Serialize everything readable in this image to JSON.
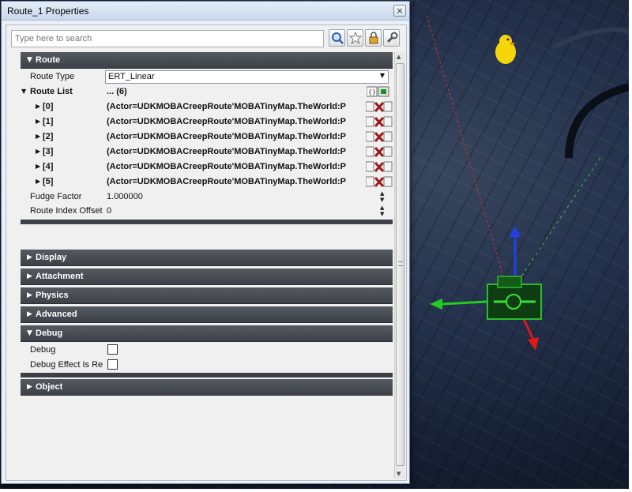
{
  "window": {
    "title": "Route_1 Properties",
    "close_glyph": "×"
  },
  "search": {
    "placeholder": "Type here to search",
    "tools": [
      "search-icon",
      "favorite-star-icon",
      "lock-icon",
      "wrench-settings-icon"
    ]
  },
  "categories": {
    "route": {
      "label": "Route",
      "expanded": true
    },
    "display": {
      "label": "Display",
      "expanded": false
    },
    "attachment": {
      "label": "Attachment",
      "expanded": false
    },
    "physics": {
      "label": "Physics",
      "expanded": false
    },
    "advanced": {
      "label": "Advanced",
      "expanded": false
    },
    "debug": {
      "label": "Debug",
      "expanded": true
    },
    "object": {
      "label": "Object",
      "expanded": false
    }
  },
  "route": {
    "route_type_label": "Route Type",
    "route_type_value": "ERT_Linear",
    "route_list_label": "Route List",
    "route_list_value": "... (6)",
    "entries": [
      {
        "index": "[0]",
        "value": "(Actor=UDKMOBACreepRoute'MOBATinyMap.TheWorld:P"
      },
      {
        "index": "[1]",
        "value": "(Actor=UDKMOBACreepRoute'MOBATinyMap.TheWorld:P"
      },
      {
        "index": "[2]",
        "value": "(Actor=UDKMOBACreepRoute'MOBATinyMap.TheWorld:P"
      },
      {
        "index": "[3]",
        "value": "(Actor=UDKMOBACreepRoute'MOBATinyMap.TheWorld:P"
      },
      {
        "index": "[4]",
        "value": "(Actor=UDKMOBACreepRoute'MOBATinyMap.TheWorld:P"
      },
      {
        "index": "[5]",
        "value": "(Actor=UDKMOBACreepRoute'MOBATinyMap.TheWorld:P"
      }
    ],
    "fudge_factor_label": "Fudge Factor",
    "fudge_factor_value": "1.000000",
    "route_index_offset_label": "Route Index Offset",
    "route_index_offset_value": "0"
  },
  "debug": {
    "debug_label": "Debug",
    "debug_checked": false,
    "debug_effect_label": "Debug Effect Is Rela",
    "debug_effect_checked": false
  },
  "colors": {
    "header_bg": "#45494f",
    "panel_bg": "#f0f0f0",
    "window_chrome": "#dce6f2",
    "viewport_bg": "#1c2536"
  }
}
